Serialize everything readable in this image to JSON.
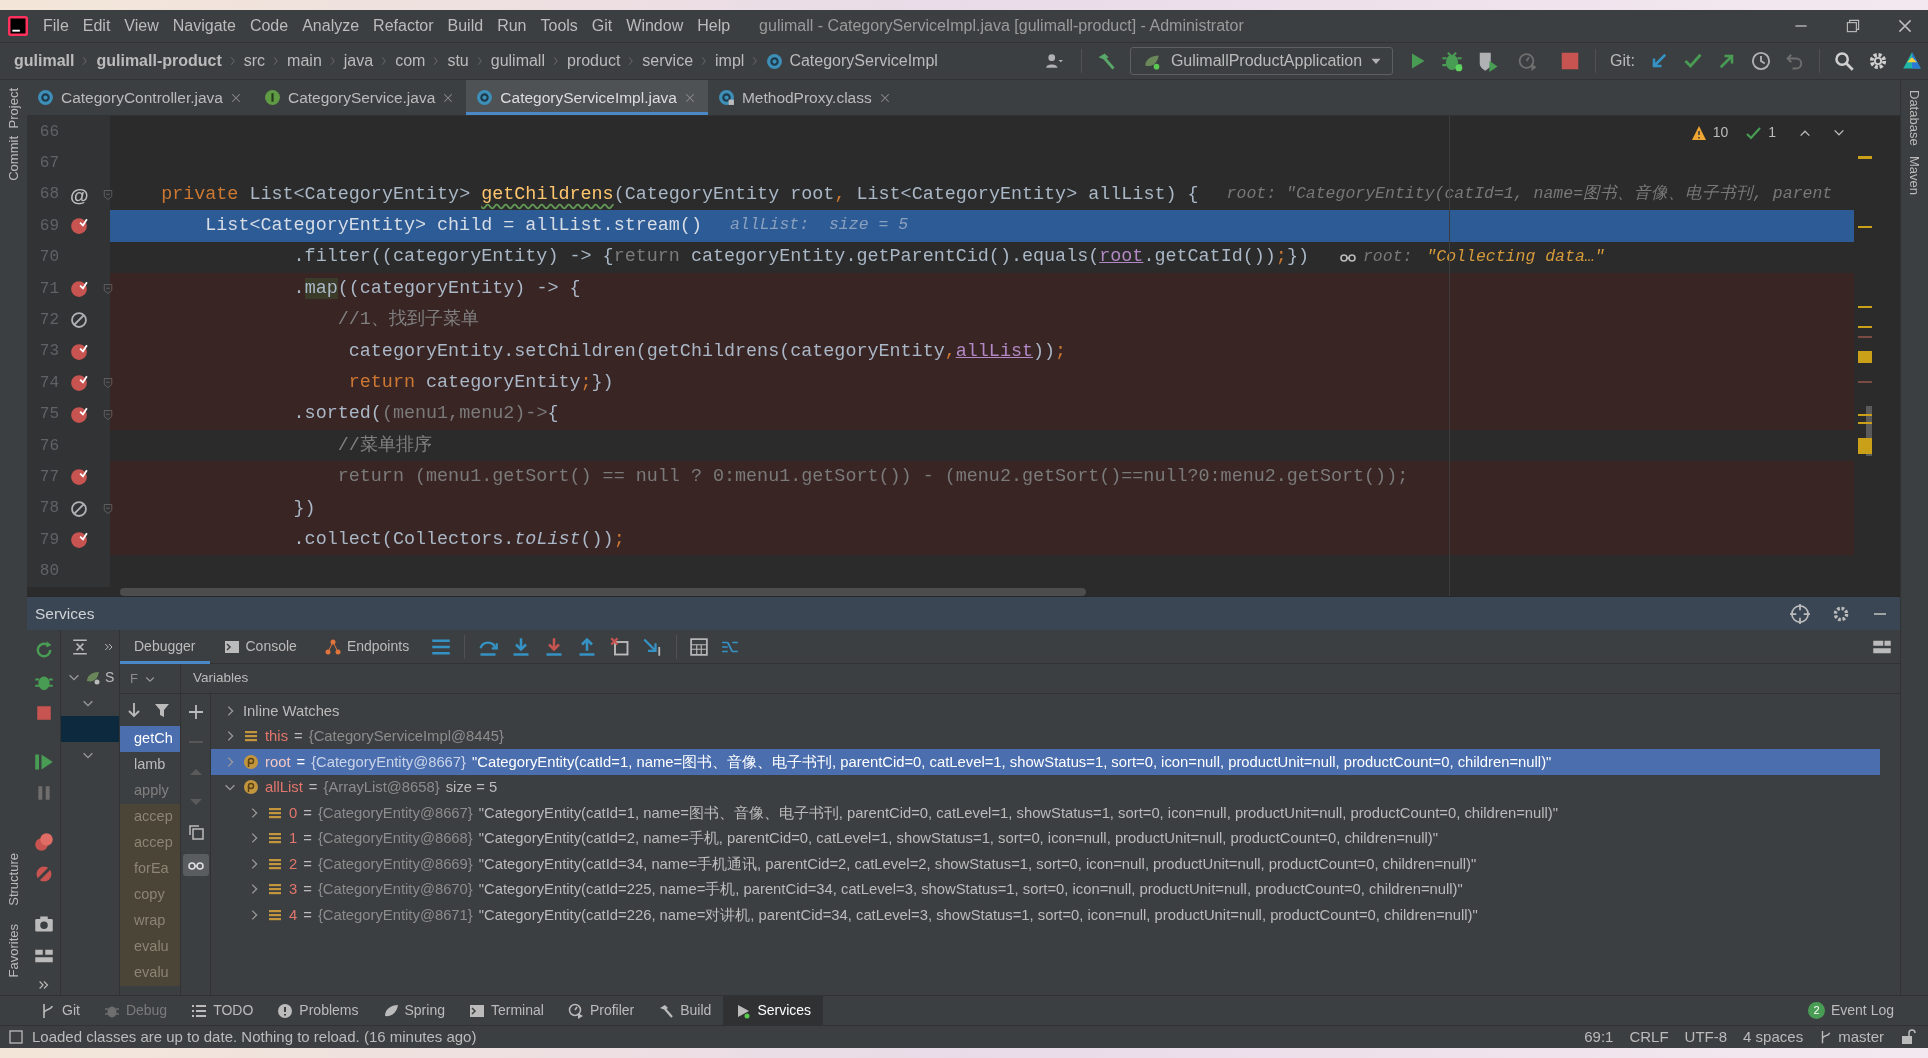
{
  "window": {
    "title": "gulimall - CategoryServiceImpl.java [gulimall-product] - Administrator"
  },
  "menu": [
    "File",
    "Edit",
    "View",
    "Navigate",
    "Code",
    "Analyze",
    "Refactor",
    "Build",
    "Run",
    "Tools",
    "Git",
    "Window",
    "Help"
  ],
  "breadcrumb": [
    {
      "label": "gulimall",
      "bold": true
    },
    {
      "label": "gulimall-product",
      "bold": true
    },
    {
      "label": "src",
      "bold": false
    },
    {
      "label": "main",
      "bold": false
    },
    {
      "label": "java",
      "bold": false
    },
    {
      "label": "com",
      "bold": false
    },
    {
      "label": "stu",
      "bold": false
    },
    {
      "label": "gulimall",
      "bold": false
    },
    {
      "label": "product",
      "bold": false
    },
    {
      "label": "service",
      "bold": false
    },
    {
      "label": "impl",
      "bold": false
    },
    {
      "label": "CategoryServiceImpl",
      "bold": false,
      "kind": "class"
    }
  ],
  "toolbar": {
    "run_config": "GulimallProductApplication",
    "git_label": "Git:"
  },
  "side_strip_left": {
    "top": [
      "Project",
      "Commit"
    ],
    "bottom": [
      "Structure",
      "Favorites"
    ]
  },
  "side_strip_right": [
    "Database",
    "Maven"
  ],
  "tabs": [
    {
      "label": "CategoryController.java",
      "kind": "class",
      "selected": false
    },
    {
      "label": "CategoryService.java",
      "kind": "interface",
      "selected": false
    },
    {
      "label": "CategoryServiceImpl.java",
      "kind": "class",
      "selected": true
    },
    {
      "label": "MethodProxy.class",
      "kind": "locked",
      "selected": false
    }
  ],
  "editor": {
    "inspections": {
      "warnings": "10",
      "passed": "1"
    },
    "lines": [
      {
        "number": "66",
        "fold": false,
        "watch": false
      },
      {
        "number": "67",
        "fold": false,
        "watch": false
      },
      {
        "number": "68",
        "symbol": "@",
        "fold": true,
        "watch": false,
        "tokens": [
          {
            "t": "    private",
            "kind": "keyword"
          },
          {
            "t": " List<CategoryEntity> ",
            "kind": "plain"
          },
          {
            "t": "getChildrens",
            "kind": "method"
          },
          {
            "t": "(CategoryEntity root",
            "kind": "plain"
          },
          {
            "t": ",",
            "kind": "punct"
          },
          {
            "t": " List<CategoryEntity> allList) {",
            "kind": "plain"
          }
        ],
        "hint": [
          {
            "t": "root: \"CategoryEntity(catId=1, name=图书、音像、电子书刊, parent",
            "kind": "hint"
          }
        ]
      },
      {
        "number": "69",
        "marker": {
          "kind": "breakpoint"
        },
        "highlight": {
          "kind": "current"
        },
        "fold": false,
        "watch": false,
        "tokens": [
          {
            "t": "        List<CategoryEntity> child = allList.stream()",
            "kind": "plain"
          }
        ],
        "hint": [
          {
            "t": "allList:  size = 5",
            "kind": "hint"
          }
        ]
      },
      {
        "number": "70",
        "fold": false,
        "watch": true,
        "tokens": [
          {
            "t": "                .filter((categoryEntity) -> {",
            "kind": "plain"
          },
          {
            "t": "return",
            "kind": "muted"
          },
          {
            "t": " categoryEntity.getParentCid().equals(",
            "kind": "plain"
          },
          {
            "t": "root",
            "kind": "link"
          },
          {
            "t": ".getCatId())",
            "kind": "plain"
          },
          {
            "t": ";",
            "kind": "punct"
          },
          {
            "t": "})",
            "kind": "plain"
          }
        ],
        "hint": [
          {
            "t": "root: ",
            "kind": "hint"
          },
          {
            "t": "\"Collecting data…\"",
            "kind": "string"
          }
        ]
      },
      {
        "number": "71",
        "marker": {
          "kind": "breakpoint"
        },
        "highlight": {
          "kind": "breakpoint"
        },
        "fold": true,
        "watch": false,
        "tokens": [
          {
            "t": "                .",
            "kind": "plain"
          },
          {
            "t": "map",
            "kind": "match"
          },
          {
            "t": "((categoryEntity) -> {",
            "kind": "plain"
          }
        ]
      },
      {
        "number": "72",
        "marker": {
          "kind": "disabled"
        },
        "highlight": {
          "kind": "breakpoint"
        },
        "fold": false,
        "watch": false,
        "tokens": [
          {
            "t": "                    //1、找到子菜单",
            "kind": "comment"
          }
        ]
      },
      {
        "number": "73",
        "marker": {
          "kind": "breakpoint"
        },
        "highlight": {
          "kind": "breakpoint"
        },
        "fold": false,
        "watch": false,
        "tokens": [
          {
            "t": "                     categoryEntity.setChildren(getChildrens(categoryEntity",
            "kind": "plain"
          },
          {
            "t": ",",
            "kind": "punct"
          },
          {
            "t": "allList",
            "kind": "link"
          },
          {
            "t": "))",
            "kind": "plain"
          },
          {
            "t": ";",
            "kind": "punct"
          }
        ]
      },
      {
        "number": "74",
        "marker": {
          "kind": "breakpoint"
        },
        "highlight": {
          "kind": "breakpoint"
        },
        "fold": true,
        "watch": false,
        "tokens": [
          {
            "t": "                     return",
            "kind": "keyword"
          },
          {
            "t": " categoryEntity",
            "kind": "plain"
          },
          {
            "t": ";",
            "kind": "punct"
          },
          {
            "t": "})",
            "kind": "plain"
          }
        ]
      },
      {
        "number": "75",
        "marker": {
          "kind": "breakpoint"
        },
        "highlight": {
          "kind": "breakpoint"
        },
        "fold": true,
        "watch": false,
        "tokens": [
          {
            "t": "                .sorted(",
            "kind": "plain"
          },
          {
            "t": "(menu1,menu2)->",
            "kind": "muted"
          },
          {
            "t": "{",
            "kind": "plain"
          }
        ]
      },
      {
        "number": "76",
        "fold": false,
        "watch": false,
        "tokens": [
          {
            "t": "                    //菜单排序",
            "kind": "comment"
          }
        ]
      },
      {
        "number": "77",
        "marker": {
          "kind": "breakpoint"
        },
        "highlight": {
          "kind": "breakpoint"
        },
        "fold": false,
        "watch": false,
        "tokens": [
          {
            "t": "                    return (menu1.getSort() == null ? 0:menu1.getSort()) - (menu2.getSort()==null?0:menu2.getSort());",
            "kind": "muted"
          }
        ]
      },
      {
        "number": "78",
        "marker": {
          "kind": "disabled"
        },
        "highlight": {
          "kind": "breakpoint"
        },
        "fold": true,
        "watch": false,
        "tokens": [
          {
            "t": "                })",
            "kind": "plain"
          }
        ]
      },
      {
        "number": "79",
        "marker": {
          "kind": "breakpoint"
        },
        "highlight": {
          "kind": "breakpoint"
        },
        "fold": false,
        "watch": false,
        "tokens": [
          {
            "t": "                .collect(Collectors.",
            "kind": "plain"
          },
          {
            "t": "toList",
            "kind": "italic"
          },
          {
            "t": "())",
            "kind": "plain"
          },
          {
            "t": ";",
            "kind": "punct"
          }
        ]
      },
      {
        "number": "80",
        "fold": false,
        "watch": false
      }
    ]
  },
  "services": {
    "title": "Services",
    "tree": [
      {
        "label": "S",
        "expanded": true,
        "selected": false
      },
      {
        "expanded": true,
        "selected": false
      },
      {
        "selected": true
      },
      {
        "expanded": true,
        "selected": false
      }
    ],
    "debugger_tabs": [
      {
        "label": "Debugger",
        "selected": true
      },
      {
        "label": "Console",
        "selected": false
      },
      {
        "label": "Endpoints",
        "selected": false
      }
    ],
    "frames_header": "F",
    "frames": [
      {
        "label": "getCh",
        "kind": "app",
        "selected": true
      },
      {
        "label": "lamb",
        "kind": "app",
        "selected": false
      },
      {
        "label": "apply",
        "kind": "nosource",
        "selected": false
      },
      {
        "label": "accep",
        "kind": "library",
        "selected": false
      },
      {
        "label": "accep",
        "kind": "library",
        "selected": false
      },
      {
        "label": "forEa",
        "kind": "library",
        "selected": false
      },
      {
        "label": "copy",
        "kind": "library",
        "selected": false
      },
      {
        "label": "wrap",
        "kind": "library",
        "selected": false
      },
      {
        "label": "evalu",
        "kind": "library",
        "selected": false
      },
      {
        "label": "evalu",
        "kind": "library",
        "selected": false
      }
    ],
    "variables_header": "Variables",
    "variables": [
      {
        "kind": "group",
        "name": "Inline Watches",
        "expanded": false,
        "selected": false
      },
      {
        "kind": "field",
        "name": "this",
        "op": "=",
        "ref": "{CategoryServiceImpl@8445}",
        "expanded": false,
        "selected": false
      },
      {
        "kind": "param",
        "name": "root",
        "op": "=",
        "ref": "{CategoryEntity@8667}",
        "value": "\"CategoryEntity(catId=1, name=图书、音像、电子书刊, parentCid=0, catLevel=1, showStatus=1, sort=0, icon=null, productUnit=null, productCount=0, children=null)\"",
        "expanded": false,
        "selected": true
      },
      {
        "kind": "param",
        "name": "allList",
        "op": "=",
        "ref": "{ArrayList@8658}",
        "value": "size = 5",
        "expanded": true,
        "selected": false,
        "children": [
          {
            "kind": "field",
            "name": "0",
            "op": "=",
            "ref": "{CategoryEntity@8667}",
            "value": "\"CategoryEntity(catId=1, name=图书、音像、电子书刊, parentCid=0, catLevel=1, showStatus=1, sort=0, icon=null, productUnit=null, productCount=0, children=null)\"",
            "expanded": false,
            "selected": false
          },
          {
            "kind": "field",
            "name": "1",
            "op": "=",
            "ref": "{CategoryEntity@8668}",
            "value": "\"CategoryEntity(catId=2, name=手机, parentCid=0, catLevel=1, showStatus=1, sort=0, icon=null, productUnit=null, productCount=0, children=null)\"",
            "expanded": false,
            "selected": false
          },
          {
            "kind": "field",
            "name": "2",
            "op": "=",
            "ref": "{CategoryEntity@8669}",
            "value": "\"CategoryEntity(catId=34, name=手机通讯, parentCid=2, catLevel=2, showStatus=1, sort=0, icon=null, productUnit=null, productCount=0, children=null)\"",
            "expanded": false,
            "selected": false
          },
          {
            "kind": "field",
            "name": "3",
            "op": "=",
            "ref": "{CategoryEntity@8670}",
            "value": "\"CategoryEntity(catId=225, name=手机, parentCid=34, catLevel=3, showStatus=1, sort=0, icon=null, productUnit=null, productCount=0, children=null)\"",
            "expanded": false,
            "selected": false
          },
          {
            "kind": "field",
            "name": "4",
            "op": "=",
            "ref": "{CategoryEntity@8671}",
            "value": "\"CategoryEntity(catId=226, name=对讲机, parentCid=34, catLevel=3, showStatus=1, sort=0, icon=null, productUnit=null, productCount=0, children=null)\"",
            "expanded": false,
            "selected": false
          }
        ]
      }
    ]
  },
  "tool_tabs": [
    {
      "label": "Git",
      "selected": false,
      "disabled": false
    },
    {
      "label": "Debug",
      "selected": false,
      "disabled": true
    },
    {
      "label": "TODO",
      "selected": false,
      "disabled": false
    },
    {
      "label": "Problems",
      "selected": false,
      "disabled": false
    },
    {
      "label": "Spring",
      "selected": false,
      "disabled": false
    },
    {
      "label": "Terminal",
      "selected": false,
      "disabled": false
    },
    {
      "label": "Profiler",
      "selected": false,
      "disabled": false
    },
    {
      "label": "Build",
      "selected": false,
      "disabled": false
    },
    {
      "label": "Services",
      "selected": true,
      "disabled": false
    }
  ],
  "event_log": {
    "count": "2",
    "label": "Event Log"
  },
  "status_bar": {
    "message": "Loaded classes are up to date. Nothing to reload. (16 minutes ago)",
    "items": [
      "69:1",
      "CRLF",
      "UTF-8",
      "4 spaces"
    ],
    "branch": "master"
  }
}
